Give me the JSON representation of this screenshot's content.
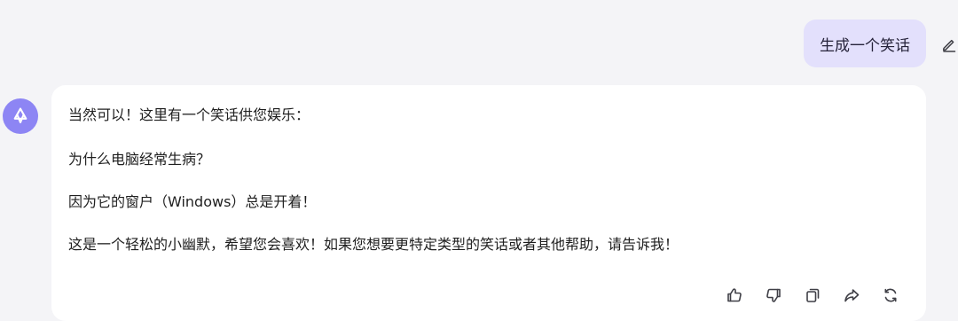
{
  "conversation": {
    "user_message": {
      "text": "生成一个笑话"
    },
    "assistant_message": {
      "lines": [
        "当然可以！这里有一个笑话供您娱乐：",
        "为什么电脑经常生病？",
        "因为它的窗户（Windows）总是开着！",
        "这是一个轻松的小幽默，希望您会喜欢！如果您想要更特定类型的笑话或者其他帮助，请告诉我！"
      ]
    }
  },
  "icons": {
    "edit": "pencil-icon",
    "avatar": "assistant-logo-icon",
    "like": "thumbs-up-icon",
    "dislike": "thumbs-down-icon",
    "copy": "copy-icon",
    "share": "share-icon",
    "regenerate": "regenerate-icon"
  },
  "colors": {
    "background": "#f4f4f7",
    "user_bubble": "#e3e0fc",
    "avatar": "#8d85f4",
    "card": "#ffffff"
  }
}
